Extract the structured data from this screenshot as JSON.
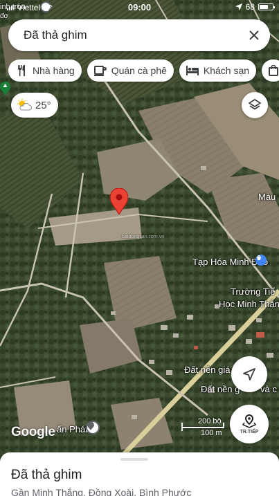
{
  "status_bar": {
    "carrier": "Viettel",
    "time": "09:00",
    "battery_percent": "68",
    "battery_level": 0.68
  },
  "search": {
    "query": "Đã thả ghim",
    "close_icon": "close-icon"
  },
  "chips": [
    {
      "label": "Nhà hàng",
      "icon": "restaurant-icon"
    },
    {
      "label": "Quán cà phê",
      "icon": "coffee-icon"
    },
    {
      "label": "Khách sạn",
      "icon": "hotel-icon"
    },
    {
      "label": "",
      "icon": "shopping-bag-icon"
    }
  ],
  "weather": {
    "temperature": "25°",
    "icon": "partly-cloudy-icon"
  },
  "map_labels": {
    "top_left_1": "inh tròn",
    "top_left_2": "đơ",
    "mau": "Màu",
    "store": "Tạp Hóa Minh Đào",
    "school_1": "Trường Tiể",
    "school_2": "Học Minh Thắn",
    "land_1": "Đất nền giá",
    "land_2": "Đất nền g",
    "land_2b": "và c",
    "village": "ấn Phát",
    "watermark": "batdongsan.com.vn"
  },
  "controls": {
    "street_view_label": "TR.TIẾP",
    "scale_top": "200 bộ",
    "scale_bottom": "100 m",
    "google_logo": "Google"
  },
  "place_sheet": {
    "title": "Đã thả ghim",
    "address": "Gần Minh Thắng, Đồng Xoài, Bình Phước"
  },
  "colors": {
    "pin": "#ea4335",
    "poi_blue": "#4285f4",
    "poi_green": "#188038"
  }
}
